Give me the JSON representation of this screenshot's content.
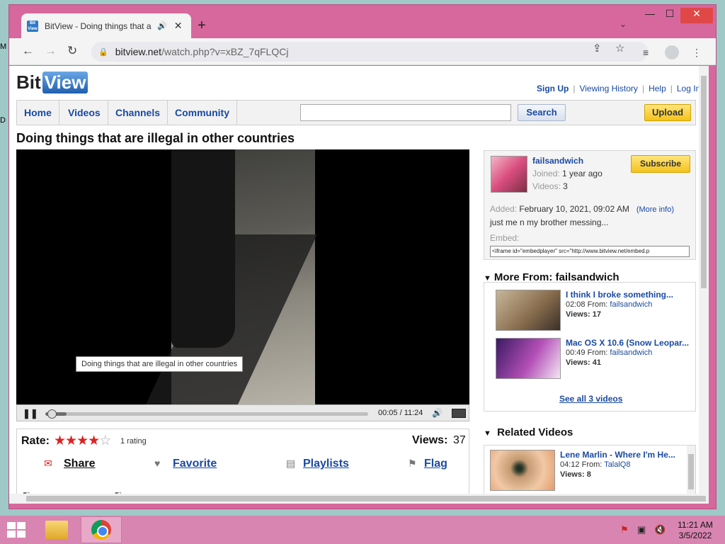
{
  "desktop": {
    "glyph_top": "M",
    "glyph_mid": "D"
  },
  "browser": {
    "tab_title": "BitView - Doing things that a",
    "tab_favicon": "Bit View",
    "url_host": "bitview.net",
    "url_rest": "/watch.php?v=xBZ_7qFLQCj",
    "icons": [
      "back-icon",
      "forward-icon",
      "reload-icon",
      "lock-icon",
      "share-icon",
      "star-icon",
      "reading-list-icon",
      "profile-icon",
      "menu-icon"
    ]
  },
  "site": {
    "logo_bit": "Bit",
    "logo_view": "View",
    "toplinks": {
      "signup": "Sign Up",
      "history": "Viewing History",
      "help": "Help",
      "login": "Log In"
    },
    "nav": [
      "Home",
      "Videos",
      "Channels",
      "Community"
    ],
    "search": {
      "value": "",
      "button": "Search"
    },
    "upload": "Upload"
  },
  "video": {
    "title": "Doing things that are illegal in other countries",
    "tooltip": "Doing things that are illegal in other countries",
    "time": "00:05 / 11:24",
    "progress": 0.007
  },
  "rating": {
    "label": "Rate:",
    "stars": 4,
    "max_stars": 5,
    "count_text": "1 rating",
    "views_label": "Views:",
    "views_value": "37"
  },
  "actions": {
    "share": "Share",
    "favorite": "Favorite",
    "playlists": "Playlists",
    "flag": "Flag"
  },
  "channel": {
    "name": "failsandwich",
    "joined_label": "Joined:",
    "joined_value": "1 year ago",
    "videos_label": "Videos:",
    "videos_value": "3",
    "subscribe": "Subscribe",
    "added_label": "Added:",
    "added_value": "February 10, 2021, 09:02 AM",
    "more_info": "(More info)",
    "description": "just me n my brother messing...",
    "embed_label": "Embed:",
    "embed_code": "<iframe id=\"embedplayer\" src=\"http://www.bitview.net/embed.p"
  },
  "more_from": {
    "title": "More From: failsandwich",
    "items": [
      {
        "title": "I think I broke something...",
        "duration": "02:08",
        "from_label": "From:",
        "from": "failsandwich",
        "views": "Views: 17"
      },
      {
        "title": "Mac OS X 10.6 (Snow Leopar...",
        "duration": "00:49",
        "from_label": "From:",
        "from": "failsandwich",
        "views": "Views: 41"
      }
    ],
    "see_all": "See all 3 videos"
  },
  "related": {
    "title": "Related Videos",
    "items": [
      {
        "title": "Lene Marlin - Where I'm He...",
        "duration": "04:12",
        "from_label": "From:",
        "from": "TalalQ8",
        "views": "Views: 8"
      }
    ]
  },
  "taskbar": {
    "time": "11:21 AM",
    "date": "3/5/2022"
  },
  "colors": {
    "window_frame": "#d7689d",
    "taskbar": "#d985b1",
    "link_blue": "#1a4aa0",
    "button_yellow": "#f4c21c",
    "star_red": "#dd2222"
  }
}
